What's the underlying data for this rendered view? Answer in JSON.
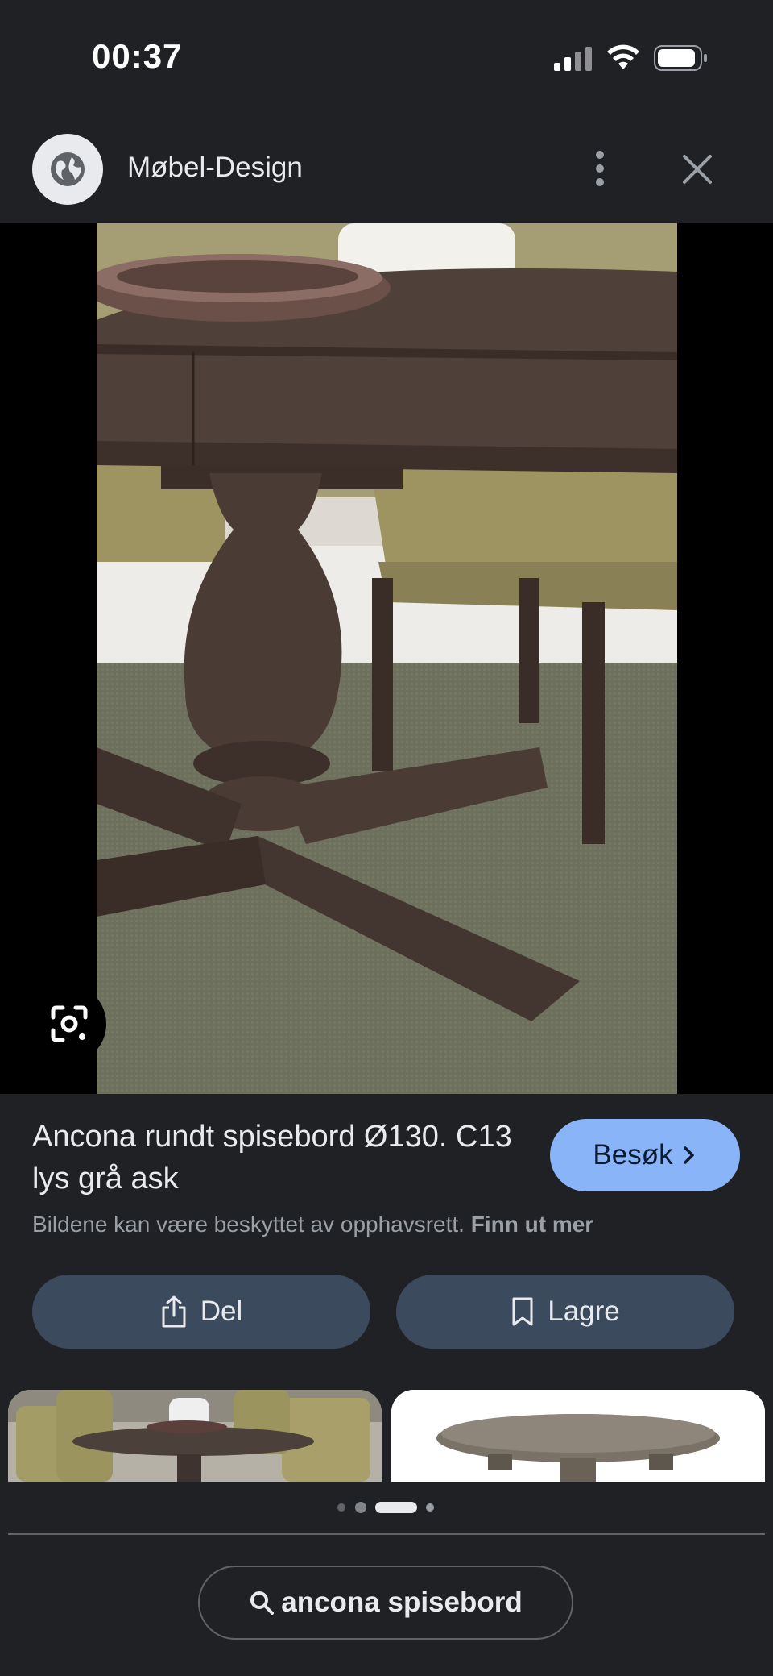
{
  "status_bar": {
    "time": "00:37",
    "signal_icon": "cellular-signal-icon",
    "wifi_icon": "wifi-icon",
    "battery_icon": "battery-icon"
  },
  "header": {
    "site_icon": "globe-icon",
    "site_name": "Møbel-Design",
    "more_icon": "more-vert-icon",
    "close_icon": "close-icon"
  },
  "image": {
    "lens_icon": "google-lens-icon"
  },
  "result": {
    "title": "Ancona rundt spisebord Ø130. C13 lys grå ask",
    "visit_label": "Besøk",
    "visit_icon": "chevron-right-icon",
    "copyright_text": "Bildene kan være beskyttet av opphavsrett.",
    "learn_more": "Finn ut mer"
  },
  "actions": {
    "share_label": "Del",
    "share_icon": "share-icon",
    "save_label": "Lagre",
    "save_icon": "bookmark-icon"
  },
  "pager": {
    "count": 4,
    "active_index": 2
  },
  "search": {
    "query": "ancona spisebord",
    "icon": "search-icon"
  },
  "colors": {
    "background": "#202124",
    "accent": "#8ab4f8",
    "button": "#3c4a5e"
  }
}
